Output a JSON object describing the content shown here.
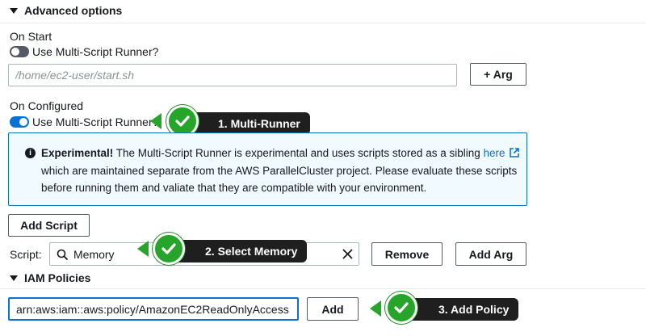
{
  "advanced": {
    "title": "Advanced options"
  },
  "on_start": {
    "label": "On Start",
    "toggle_label": "Use Multi-Script Runner?",
    "script_placeholder": "/home/ec2-user/start.sh",
    "arg_button": "+ Arg"
  },
  "on_configured": {
    "label": "On Configured",
    "toggle_label": "Use Multi-Script Runner?",
    "info": {
      "bold": "Experimental!",
      "text_before_link": " The Multi-Script Runner is experimental and uses scripts stored as a sibling ",
      "link": "here",
      "line2": "which are maintained separate from the AWS ParallelCluster project. Please evaluate these scripts",
      "line3": "before running them and valiate that they are compatible with your environment."
    },
    "add_script_button": "Add Script",
    "script_label": "Script:",
    "script_value": "Memory",
    "remove_button": "Remove",
    "add_arg_button": "Add Arg"
  },
  "iam": {
    "title": "IAM Policies",
    "policy_value": "arn:aws:iam::aws:policy/AmazonEC2ReadOnlyAccess",
    "add_button": "Add"
  },
  "callouts": {
    "step1": "1. Multi-Runner",
    "step2": "2. Select Memory",
    "step3": "3. Add Policy"
  },
  "colors": {
    "accent": "#0972d3",
    "toggle_off": "#545b64",
    "info_border": "#0073bb",
    "callout_bg": "#1f1f1f",
    "check_green": "#27a52a"
  }
}
